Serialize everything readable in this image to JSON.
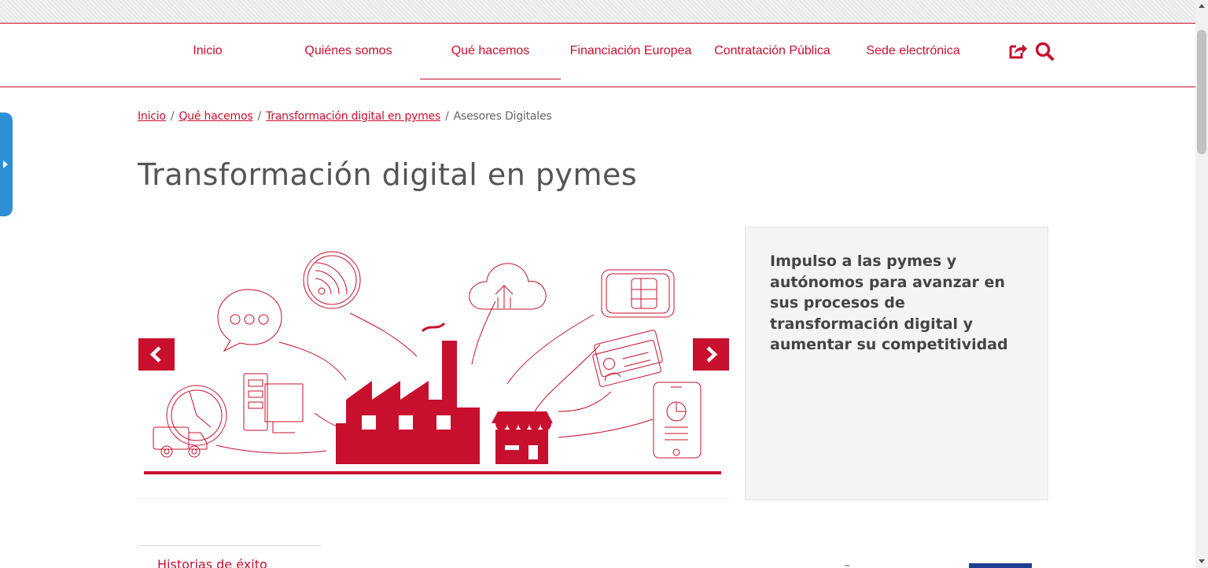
{
  "nav": {
    "items": [
      {
        "label": "Inicio"
      },
      {
        "label": "Quiénes somos"
      },
      {
        "label": "Qué hacemos"
      },
      {
        "label": "Financiación Europea"
      },
      {
        "label": "Contratación Pública"
      },
      {
        "label": "Sede electrónica"
      }
    ],
    "active_index": 2,
    "icons": [
      "share-icon",
      "search-icon"
    ]
  },
  "breadcrumb": {
    "items": [
      "Inicio",
      "Qué hacemos",
      "Transformación digital en pymes"
    ],
    "current": "Asesores Digitales",
    "separator": "/"
  },
  "page": {
    "title": "Transformación digital en pymes"
  },
  "carousel": {
    "prev_icon": "chevron-left-icon",
    "next_icon": "chevron-right-icon"
  },
  "info": {
    "text": "Impulso a las pymes y autónomos para avanzar en sus procesos de transformación digital y aumentar su competitividad"
  },
  "subnav": {
    "item": "Historias de éxito"
  },
  "colors": {
    "brand": "#c8102e",
    "side_tab": "#2f8fd4",
    "text": "#555555",
    "panel": "#f4f4f4"
  }
}
